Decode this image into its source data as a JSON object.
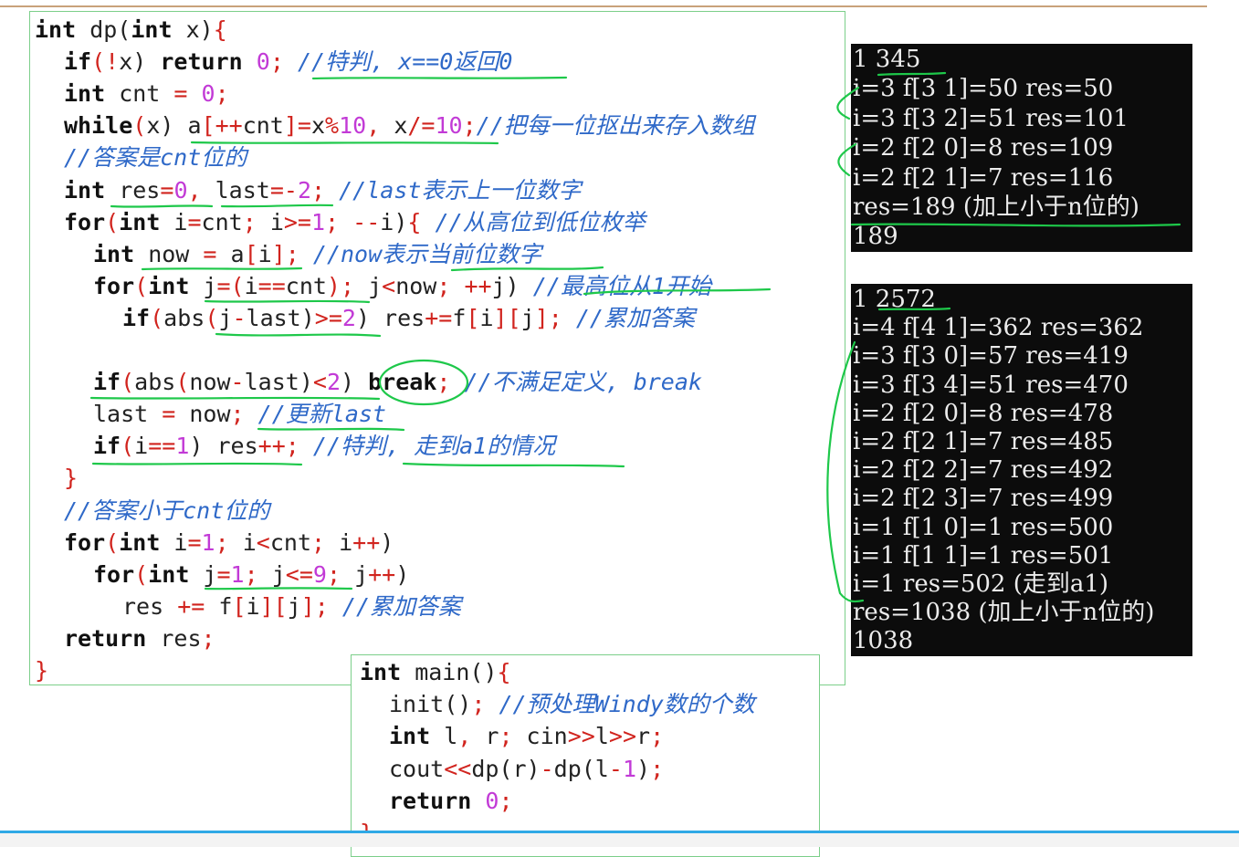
{
  "dp_code": [
    {
      "indent": 0,
      "tokens": [
        {
          "c": "kw",
          "t": "int"
        },
        {
          "c": "tx",
          "t": " dp("
        },
        {
          "c": "kw",
          "t": "int"
        },
        {
          "c": "tx",
          "t": " x)"
        },
        {
          "c": "op",
          "t": "{"
        }
      ]
    },
    {
      "indent": 1,
      "tokens": [
        {
          "c": "kw",
          "t": "if"
        },
        {
          "c": "op",
          "t": "(!"
        },
        {
          "c": "tx",
          "t": "x) "
        },
        {
          "c": "kw",
          "t": "return"
        },
        {
          "c": "tx",
          "t": " "
        },
        {
          "c": "num",
          "t": "0"
        },
        {
          "c": "op",
          "t": ";"
        },
        {
          "c": "tx",
          "t": " "
        },
        {
          "c": "cm",
          "t": "//特判, x==0返回0"
        }
      ]
    },
    {
      "indent": 1,
      "tokens": [
        {
          "c": "kw",
          "t": "int"
        },
        {
          "c": "tx",
          "t": " cnt "
        },
        {
          "c": "op",
          "t": "="
        },
        {
          "c": "tx",
          "t": " "
        },
        {
          "c": "num",
          "t": "0"
        },
        {
          "c": "op",
          "t": ";"
        }
      ]
    },
    {
      "indent": 1,
      "tokens": [
        {
          "c": "kw",
          "t": "while"
        },
        {
          "c": "op",
          "t": "("
        },
        {
          "c": "tx",
          "t": "x) a"
        },
        {
          "c": "op",
          "t": "[++"
        },
        {
          "c": "tx",
          "t": "cnt"
        },
        {
          "c": "op",
          "t": "]="
        },
        {
          "c": "tx",
          "t": "x"
        },
        {
          "c": "op",
          "t": "%"
        },
        {
          "c": "num",
          "t": "10"
        },
        {
          "c": "op",
          "t": ","
        },
        {
          "c": "tx",
          "t": " x"
        },
        {
          "c": "op",
          "t": "/="
        },
        {
          "c": "num",
          "t": "10"
        },
        {
          "c": "op",
          "t": ";"
        },
        {
          "c": "cm",
          "t": "//把每一位抠出来存入数组"
        }
      ]
    },
    {
      "indent": 1,
      "tokens": [
        {
          "c": "cm",
          "t": "//答案是cnt位的"
        }
      ]
    },
    {
      "indent": 1,
      "tokens": [
        {
          "c": "kw",
          "t": "int"
        },
        {
          "c": "tx",
          "t": " res"
        },
        {
          "c": "op",
          "t": "="
        },
        {
          "c": "num",
          "t": "0"
        },
        {
          "c": "op",
          "t": ","
        },
        {
          "c": "tx",
          "t": " last"
        },
        {
          "c": "op",
          "t": "=-"
        },
        {
          "c": "num",
          "t": "2"
        },
        {
          "c": "op",
          "t": ";"
        },
        {
          "c": "tx",
          "t": " "
        },
        {
          "c": "cm",
          "t": "//last表示上一位数字"
        }
      ]
    },
    {
      "indent": 1,
      "tokens": [
        {
          "c": "kw",
          "t": "for"
        },
        {
          "c": "op",
          "t": "("
        },
        {
          "c": "kw",
          "t": "int"
        },
        {
          "c": "tx",
          "t": " i"
        },
        {
          "c": "op",
          "t": "="
        },
        {
          "c": "tx",
          "t": "cnt"
        },
        {
          "c": "op",
          "t": ";"
        },
        {
          "c": "tx",
          "t": " i"
        },
        {
          "c": "op",
          "t": ">="
        },
        {
          "c": "num",
          "t": "1"
        },
        {
          "c": "op",
          "t": ";"
        },
        {
          "c": "tx",
          "t": " "
        },
        {
          "c": "op",
          "t": "--"
        },
        {
          "c": "tx",
          "t": "i)"
        },
        {
          "c": "op",
          "t": "{"
        },
        {
          "c": "tx",
          "t": " "
        },
        {
          "c": "cm",
          "t": "//从高位到低位枚举"
        }
      ]
    },
    {
      "indent": 2,
      "tokens": [
        {
          "c": "kw",
          "t": "int"
        },
        {
          "c": "tx",
          "t": " now "
        },
        {
          "c": "op",
          "t": "="
        },
        {
          "c": "tx",
          "t": " a"
        },
        {
          "c": "op",
          "t": "["
        },
        {
          "c": "tx",
          "t": "i"
        },
        {
          "c": "op",
          "t": "];"
        },
        {
          "c": "tx",
          "t": " "
        },
        {
          "c": "cm",
          "t": "//now表示当前位数字"
        }
      ]
    },
    {
      "indent": 2,
      "tokens": [
        {
          "c": "kw",
          "t": "for"
        },
        {
          "c": "op",
          "t": "("
        },
        {
          "c": "kw",
          "t": "int"
        },
        {
          "c": "tx",
          "t": " j"
        },
        {
          "c": "op",
          "t": "=("
        },
        {
          "c": "tx",
          "t": "i"
        },
        {
          "c": "op",
          "t": "=="
        },
        {
          "c": "tx",
          "t": "cnt"
        },
        {
          "c": "op",
          "t": ");"
        },
        {
          "c": "tx",
          "t": " j"
        },
        {
          "c": "op",
          "t": "<"
        },
        {
          "c": "tx",
          "t": "now"
        },
        {
          "c": "op",
          "t": ";"
        },
        {
          "c": "tx",
          "t": " "
        },
        {
          "c": "op",
          "t": "++"
        },
        {
          "c": "tx",
          "t": "j) "
        },
        {
          "c": "cm",
          "t": "//最高位从1开始"
        }
      ]
    },
    {
      "indent": 3,
      "tokens": [
        {
          "c": "kw",
          "t": "if"
        },
        {
          "c": "op",
          "t": "("
        },
        {
          "c": "tx",
          "t": "abs"
        },
        {
          "c": "op",
          "t": "("
        },
        {
          "c": "tx",
          "t": "j"
        },
        {
          "c": "op",
          "t": "-"
        },
        {
          "c": "tx",
          "t": "last)"
        },
        {
          "c": "op",
          "t": ">="
        },
        {
          "c": "num",
          "t": "2"
        },
        {
          "c": "tx",
          "t": ") res"
        },
        {
          "c": "op",
          "t": "+="
        },
        {
          "c": "tx",
          "t": "f"
        },
        {
          "c": "op",
          "t": "["
        },
        {
          "c": "tx",
          "t": "i"
        },
        {
          "c": "op",
          "t": "]["
        },
        {
          "c": "tx",
          "t": "j"
        },
        {
          "c": "op",
          "t": "];"
        },
        {
          "c": "tx",
          "t": " "
        },
        {
          "c": "cm",
          "t": "//累加答案"
        }
      ]
    },
    {
      "indent": 0,
      "tokens": []
    },
    {
      "indent": 2,
      "tokens": [
        {
          "c": "kw",
          "t": "if"
        },
        {
          "c": "op",
          "t": "("
        },
        {
          "c": "tx",
          "t": "abs"
        },
        {
          "c": "op",
          "t": "("
        },
        {
          "c": "tx",
          "t": "now"
        },
        {
          "c": "op",
          "t": "-"
        },
        {
          "c": "tx",
          "t": "last)"
        },
        {
          "c": "op",
          "t": "<"
        },
        {
          "c": "num",
          "t": "2"
        },
        {
          "c": "tx",
          "t": ") "
        },
        {
          "c": "kw",
          "t": "break"
        },
        {
          "c": "op",
          "t": ";"
        },
        {
          "c": "tx",
          "t": " "
        },
        {
          "c": "cm",
          "t": "//不满足定义, break"
        }
      ]
    },
    {
      "indent": 2,
      "tokens": [
        {
          "c": "tx",
          "t": "last "
        },
        {
          "c": "op",
          "t": "="
        },
        {
          "c": "tx",
          "t": " now"
        },
        {
          "c": "op",
          "t": ";"
        },
        {
          "c": "tx",
          "t": " "
        },
        {
          "c": "cm",
          "t": "//更新last"
        }
      ]
    },
    {
      "indent": 2,
      "tokens": [
        {
          "c": "kw",
          "t": "if"
        },
        {
          "c": "op",
          "t": "("
        },
        {
          "c": "tx",
          "t": "i"
        },
        {
          "c": "op",
          "t": "=="
        },
        {
          "c": "num",
          "t": "1"
        },
        {
          "c": "tx",
          "t": ") res"
        },
        {
          "c": "op",
          "t": "++;"
        },
        {
          "c": "tx",
          "t": " "
        },
        {
          "c": "cm",
          "t": "//特判, 走到a1的情况"
        }
      ]
    },
    {
      "indent": 1,
      "tokens": [
        {
          "c": "op",
          "t": "}"
        }
      ]
    },
    {
      "indent": 1,
      "tokens": [
        {
          "c": "cm",
          "t": "//答案小于cnt位的"
        }
      ]
    },
    {
      "indent": 1,
      "tokens": [
        {
          "c": "kw",
          "t": "for"
        },
        {
          "c": "op",
          "t": "("
        },
        {
          "c": "kw",
          "t": "int"
        },
        {
          "c": "tx",
          "t": " i"
        },
        {
          "c": "op",
          "t": "="
        },
        {
          "c": "num",
          "t": "1"
        },
        {
          "c": "op",
          "t": ";"
        },
        {
          "c": "tx",
          "t": " i"
        },
        {
          "c": "op",
          "t": "<"
        },
        {
          "c": "tx",
          "t": "cnt"
        },
        {
          "c": "op",
          "t": ";"
        },
        {
          "c": "tx",
          "t": " i"
        },
        {
          "c": "op",
          "t": "++"
        },
        {
          "c": "tx",
          "t": ")"
        }
      ]
    },
    {
      "indent": 2,
      "tokens": [
        {
          "c": "kw",
          "t": "for"
        },
        {
          "c": "op",
          "t": "("
        },
        {
          "c": "kw",
          "t": "int"
        },
        {
          "c": "tx",
          "t": " j"
        },
        {
          "c": "op",
          "t": "="
        },
        {
          "c": "num",
          "t": "1"
        },
        {
          "c": "op",
          "t": ";"
        },
        {
          "c": "tx",
          "t": " j"
        },
        {
          "c": "op",
          "t": "<="
        },
        {
          "c": "num",
          "t": "9"
        },
        {
          "c": "op",
          "t": ";"
        },
        {
          "c": "tx",
          "t": " j"
        },
        {
          "c": "op",
          "t": "++"
        },
        {
          "c": "tx",
          "t": ")"
        }
      ]
    },
    {
      "indent": 3,
      "tokens": [
        {
          "c": "tx",
          "t": "res "
        },
        {
          "c": "op",
          "t": "+="
        },
        {
          "c": "tx",
          "t": " f"
        },
        {
          "c": "op",
          "t": "["
        },
        {
          "c": "tx",
          "t": "i"
        },
        {
          "c": "op",
          "t": "]["
        },
        {
          "c": "tx",
          "t": "j"
        },
        {
          "c": "op",
          "t": "];"
        },
        {
          "c": "tx",
          "t": " "
        },
        {
          "c": "cm",
          "t": "//累加答案"
        }
      ]
    },
    {
      "indent": 1,
      "tokens": [
        {
          "c": "kw",
          "t": "return"
        },
        {
          "c": "tx",
          "t": " res"
        },
        {
          "c": "op",
          "t": ";"
        }
      ]
    },
    {
      "indent": 0,
      "tokens": [
        {
          "c": "op",
          "t": "}"
        }
      ]
    }
  ],
  "main_code": [
    {
      "indent": 0,
      "tokens": [
        {
          "c": "kw",
          "t": "int"
        },
        {
          "c": "tx",
          "t": " main()"
        },
        {
          "c": "op",
          "t": "{"
        }
      ]
    },
    {
      "indent": 1,
      "tokens": [
        {
          "c": "tx",
          "t": "init()"
        },
        {
          "c": "op",
          "t": ";"
        },
        {
          "c": "tx",
          "t": " "
        },
        {
          "c": "cm",
          "t": "//预处理Windy数的个数"
        }
      ]
    },
    {
      "indent": 1,
      "tokens": [
        {
          "c": "kw",
          "t": "int"
        },
        {
          "c": "tx",
          "t": " l"
        },
        {
          "c": "op",
          "t": ","
        },
        {
          "c": "tx",
          "t": " r"
        },
        {
          "c": "op",
          "t": ";"
        },
        {
          "c": "tx",
          "t": " cin"
        },
        {
          "c": "op",
          "t": ">>"
        },
        {
          "c": "tx",
          "t": "l"
        },
        {
          "c": "op",
          "t": ">>"
        },
        {
          "c": "tx",
          "t": "r"
        },
        {
          "c": "op",
          "t": ";"
        }
      ]
    },
    {
      "indent": 1,
      "tokens": [
        {
          "c": "tx",
          "t": "cout"
        },
        {
          "c": "op",
          "t": "<<"
        },
        {
          "c": "tx",
          "t": "dp(r)"
        },
        {
          "c": "op",
          "t": "-"
        },
        {
          "c": "tx",
          "t": "dp(l"
        },
        {
          "c": "op",
          "t": "-"
        },
        {
          "c": "num",
          "t": "1"
        },
        {
          "c": "tx",
          "t": ")"
        },
        {
          "c": "op",
          "t": ";"
        }
      ]
    },
    {
      "indent": 1,
      "tokens": [
        {
          "c": "kw",
          "t": "return"
        },
        {
          "c": "tx",
          "t": " "
        },
        {
          "c": "num",
          "t": "0"
        },
        {
          "c": "op",
          "t": ";"
        }
      ]
    },
    {
      "indent": 0,
      "tokens": [
        {
          "c": "op",
          "t": "}"
        }
      ]
    }
  ],
  "terminal_top": [
    "1 345",
    "i=3 f[3 1]=50 res=50",
    "i=3 f[3 2]=51 res=101",
    "i=2 f[2 0]=8 res=109",
    "i=2 f[2 1]=7 res=116",
    "res=189 (加上小于n位的)",
    "189"
  ],
  "terminal_bottom": [
    "1 2572",
    "i=4 f[4 1]=362 res=362",
    "i=3 f[3 0]=57 res=419",
    "i=3 f[3 4]=51 res=470",
    "i=2 f[2 0]=8 res=478",
    "i=2 f[2 1]=7 res=485",
    "i=2 f[2 2]=7 res=492",
    "i=2 f[2 3]=7 res=499",
    "i=1 f[1 0]=1 res=500",
    "i=1 f[1 1]=1 res=501",
    "i=1 res=502 (走到a1)",
    "res=1038 (加上小于n位的)",
    "1038"
  ],
  "colors": {
    "keyword": "#111111",
    "operator": "#d1241e",
    "number": "#c23ad6",
    "comment": "#2f69c8",
    "annotation_pen": "#1ec84a",
    "terminal_bg": "#0c0c0c",
    "terminal_text": "#ececec",
    "accent_bar": "#2fa9e6"
  }
}
